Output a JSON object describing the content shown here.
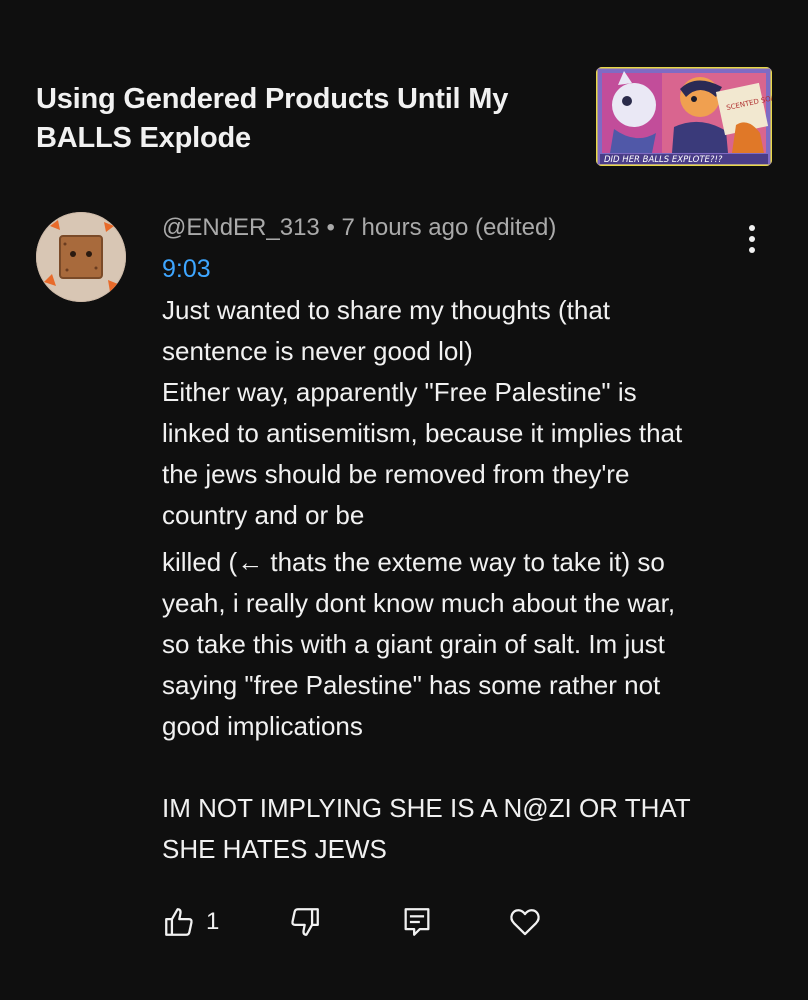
{
  "video": {
    "title_line1": "Using Gendered Products Until My",
    "title_line2": "BALLS Explode",
    "thumbnail_caption": "DID HER BALLS EXPLOTE?!?",
    "thumbnail_sign": "SCENTED SOAP"
  },
  "comment": {
    "author": "@ENdER_313",
    "separator": "•",
    "time": "7 hours ago (edited)",
    "timestamp_link": "9:03",
    "lines": [
      "Just wanted to share my thoughts (that",
      "sentence is never good lol)",
      "Either way, apparently \"Free Palestine\" is",
      "linked to antisemitism, because it implies that",
      "the jews should be removed from they're",
      "country and or be",
      "killed (← thats the exteme way to take it) so",
      "yeah, i really dont know much about the war,",
      "so take this with a giant grain of salt. Im just",
      "saying \"free Palestine\" has some rather not",
      "good implications",
      "",
      "IM NOT IMPLYING SHE IS A N@ZI OR THAT",
      "SHE HATES JEWS"
    ],
    "like_count": "1"
  },
  "icons": {
    "like": "thumbs-up-icon",
    "dislike": "thumbs-down-icon",
    "reply": "reply-icon",
    "heart": "heart-icon",
    "more": "more-vertical-icon"
  },
  "colors": {
    "background": "#0f0f0f",
    "text": "#f1f1f1",
    "secondary_text": "#aaaaaa",
    "link": "#3ea6ff"
  }
}
